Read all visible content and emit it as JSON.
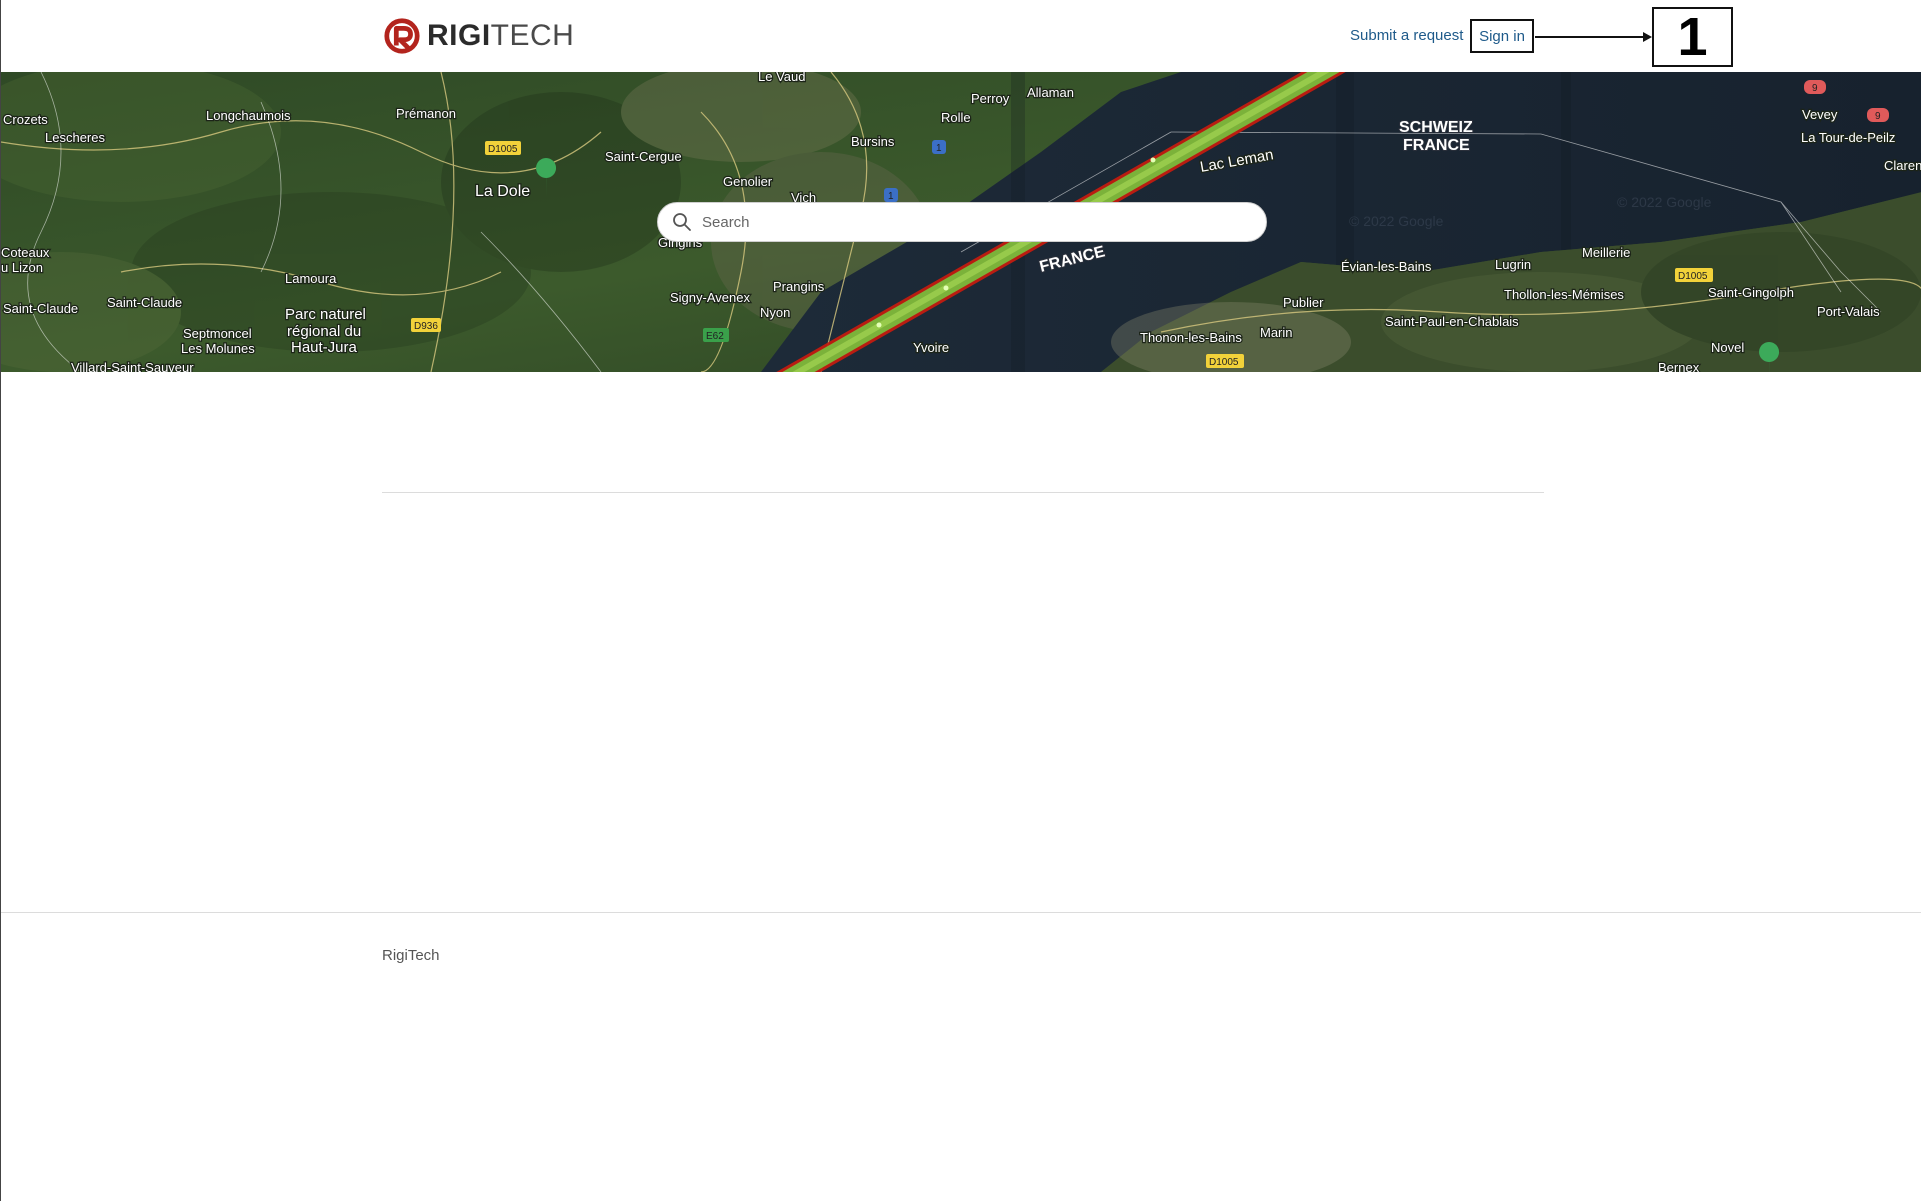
{
  "header": {
    "logo": {
      "brand_bold": "RIGI",
      "brand_light": "TECH"
    },
    "nav": {
      "submit_request": "Submit a request",
      "sign_in": "Sign in"
    },
    "annotation_label": "1"
  },
  "hero": {
    "map": {
      "labels": [
        "Le Vaud",
        "Perroy",
        "Allaman",
        "Rolle",
        "Longchaumois",
        "Prémanon",
        "Crozets",
        "Lescheres",
        "Saint-Cergue",
        "Bursins",
        "La Dole",
        "Genolier",
        "Vich",
        "Gingins",
        "Lac Leman",
        "SCHWEIZ",
        "FRANCE",
        "FRANCE",
        "Vevey",
        "La Tour-de-Peilz",
        "Clarens",
        "Coteaux",
        "u Lizon",
        "Lamoura",
        "Signy-Avenex",
        "Prangins",
        "Nyon",
        "Saint-Claude",
        "Saint-Claude",
        "Parc naturel",
        "régional du",
        "Haut-Jura",
        "Septmoncel",
        "Les Molunes",
        "Villard-Saint-Sauveur",
        "Yvoire",
        "Évian-les-Bains",
        "Lugrin",
        "Meillerie",
        "Publier",
        "Thollon-les-Mémises",
        "Saint-Gingolph",
        "Port-Valais",
        "Thonon-les-Bains",
        "Marin",
        "Saint-Paul-en-Chablais",
        "Novel",
        "Bernex",
        "© 2022 Google",
        "© 2022 Google"
      ],
      "road_badges": [
        "D1005",
        "D936",
        "E62",
        "D1005",
        "D1005",
        "1",
        "1",
        "9",
        "9"
      ]
    },
    "search": {
      "placeholder": "Search"
    }
  },
  "footer": {
    "brand": "RigiTech"
  },
  "colors": {
    "link": "#1e5a8a",
    "logo_red": "#b3241d",
    "divider": "#dcdcdc"
  }
}
